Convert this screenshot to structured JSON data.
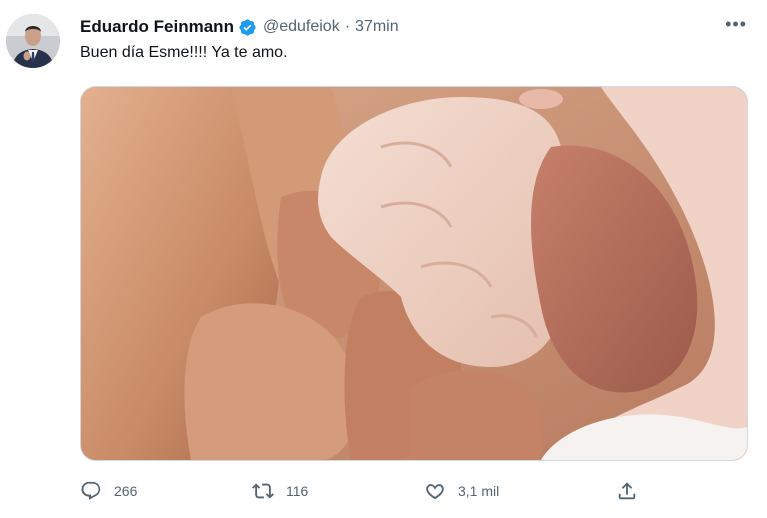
{
  "tweet": {
    "author_name": "Eduardo Feinmann",
    "handle": "@edufeiok",
    "separator": "·",
    "time": "37min",
    "text": "Buen día Esme!!!!  Ya te amo.",
    "more_label": "•••",
    "verified": true,
    "accent_color": "#1d9bf0"
  },
  "actions": {
    "reply": {
      "icon": "reply-icon",
      "count": "266"
    },
    "retweet": {
      "icon": "retweet-icon",
      "count": "116"
    },
    "like": {
      "icon": "heart-icon",
      "count": "3,1 mil"
    },
    "share": {
      "icon": "share-icon"
    }
  }
}
